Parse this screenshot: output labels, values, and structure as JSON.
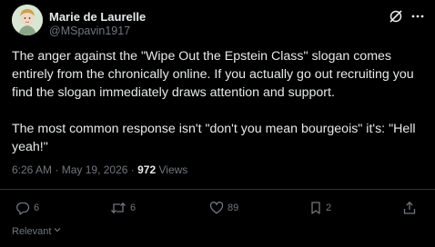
{
  "author": {
    "display_name": "Marie de Laurelle",
    "handle": "@MSpavin1917",
    "avatar_icon": "avatar-illustration"
  },
  "post": {
    "paragraph_1": "The anger against the \"Wipe Out the Epstein Class\" slogan comes entirely from the chronically online. If you actually go out recruiting you find the slogan immediately draws attention and support.",
    "paragraph_2": "The most common response isn't \"don't you mean bourgeois\" it's: \"Hell yeah!\""
  },
  "meta": {
    "time": "6:26 AM",
    "separator": "·",
    "date": "May 19, 2026",
    "views_count": "972",
    "views_label": "Views"
  },
  "actions": {
    "replies": "6",
    "reposts": "6",
    "likes": "89",
    "bookmarks": "2"
  },
  "sort": {
    "label": "Relevant"
  },
  "colors": {
    "background": "#000000",
    "text": "#e7e9ea",
    "muted": "#71767b",
    "divider": "#2f3336"
  }
}
